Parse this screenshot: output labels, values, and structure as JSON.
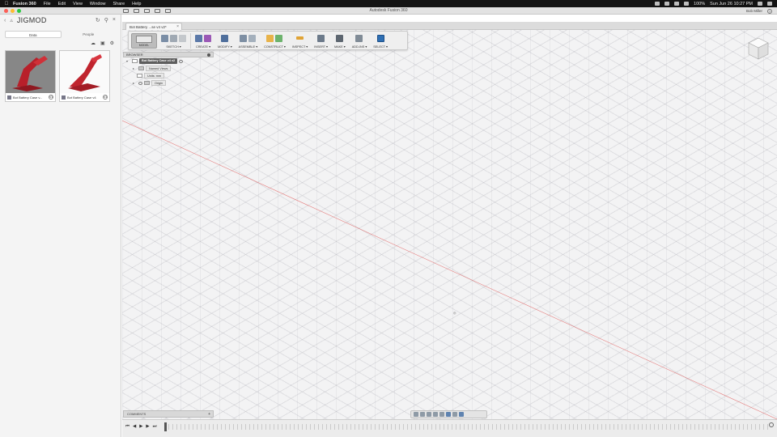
{
  "menubar": {
    "app_name": "Fusion 360",
    "items": [
      "File",
      "Edit",
      "View",
      "Window",
      "Share",
      "Help"
    ],
    "battery": "100%",
    "clock": "Sun Jun 26  10:27 PM"
  },
  "window": {
    "title": "Autodesk Fusion 360",
    "user": "Bob Miller"
  },
  "left_panel": {
    "project": "JIGMOD",
    "tabs": [
      "Data",
      "People"
    ],
    "active_tab": "Data",
    "cards": [
      {
        "name": "Bot Battery Case v...",
        "version": "V1"
      },
      {
        "name": "Bot Battery Case v4",
        "version": "V1"
      }
    ]
  },
  "document_tab": {
    "label": "Bot Battery ...se v4 v2*",
    "close": "×"
  },
  "toolbar": {
    "workspace": "MODEL",
    "groups": [
      "SKETCH ▾",
      "CREATE ▾",
      "MODIFY ▾",
      "ASSEMBLE ▾",
      "CONSTRUCT ▾",
      "INSPECT ▾",
      "INSERT ▾",
      "MAKE ▾",
      "ADD-INS ▾",
      "SELECT ▾"
    ]
  },
  "browser": {
    "header": "BROWSER",
    "root": "Bot Battery Case v4 v2",
    "items": [
      "Named Views",
      "Units: mm",
      "Origin"
    ]
  },
  "comments": {
    "label": "COMMENTS"
  },
  "colors": {
    "accent_blue": "#3a7bd5",
    "axis_red": "#e05050",
    "part_red": "#b8202a"
  }
}
